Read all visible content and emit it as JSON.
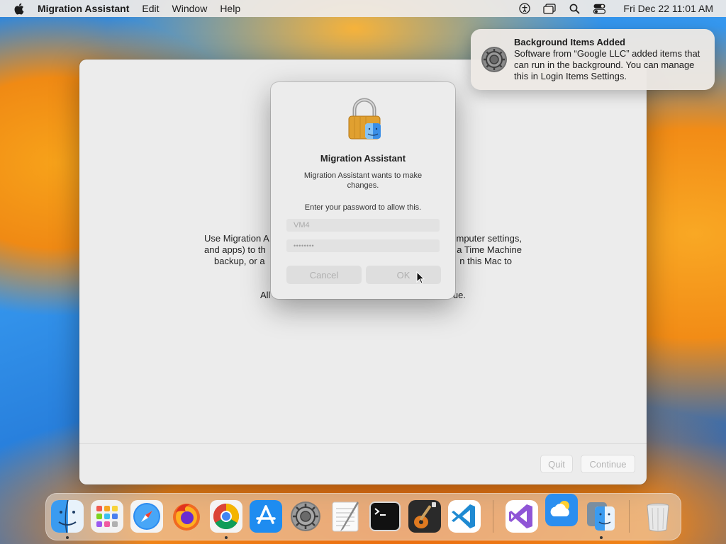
{
  "menubar": {
    "app_name": "Migration Assistant",
    "menus": [
      "Edit",
      "Window",
      "Help"
    ],
    "clock": "Fri Dec 22  11:01 AM",
    "status_icons": [
      "accessibility-icon",
      "screen-mirroring-icon",
      "spotlight-search-icon",
      "control-center-icon"
    ]
  },
  "window": {
    "body_left": "Use Migration A",
    "body_right": "mputer settings,",
    "body_left_2": "and apps) to th",
    "body_right_2": "a Time Machine",
    "body_left_3": "backup, or a",
    "body_right_3": "n this Mac to",
    "note_left": "All",
    "note_right": "ue.",
    "quit_label": "Quit",
    "continue_label": "Continue"
  },
  "dialog": {
    "title": "Migration Assistant",
    "message": "Migration Assistant wants to make changes.",
    "prompt": "Enter your password to allow this.",
    "username": "VM4",
    "password_mask": "••••••••",
    "cancel_label": "Cancel",
    "ok_label": "OK"
  },
  "notification": {
    "title": "Background Items Added",
    "body": "Software from “Google LLC” added items that can run in the background. You can manage this in Login Items Settings."
  },
  "dock": {
    "items": [
      {
        "name": "finder",
        "running": true
      },
      {
        "name": "launchpad",
        "running": false
      },
      {
        "name": "safari",
        "running": false
      },
      {
        "name": "firefox",
        "running": false
      },
      {
        "name": "chrome",
        "running": true
      },
      {
        "name": "app-store",
        "running": false
      },
      {
        "name": "system-settings",
        "running": false
      },
      {
        "name": "textedit",
        "running": false
      },
      {
        "name": "terminal",
        "running": false
      },
      {
        "name": "garageband",
        "running": false
      },
      {
        "name": "vscode",
        "running": false
      },
      {
        "name": "visual-studio",
        "running": false
      },
      {
        "name": "weather",
        "running": false
      },
      {
        "name": "migration-assistant",
        "running": true
      },
      {
        "name": "trash",
        "running": false
      }
    ]
  }
}
